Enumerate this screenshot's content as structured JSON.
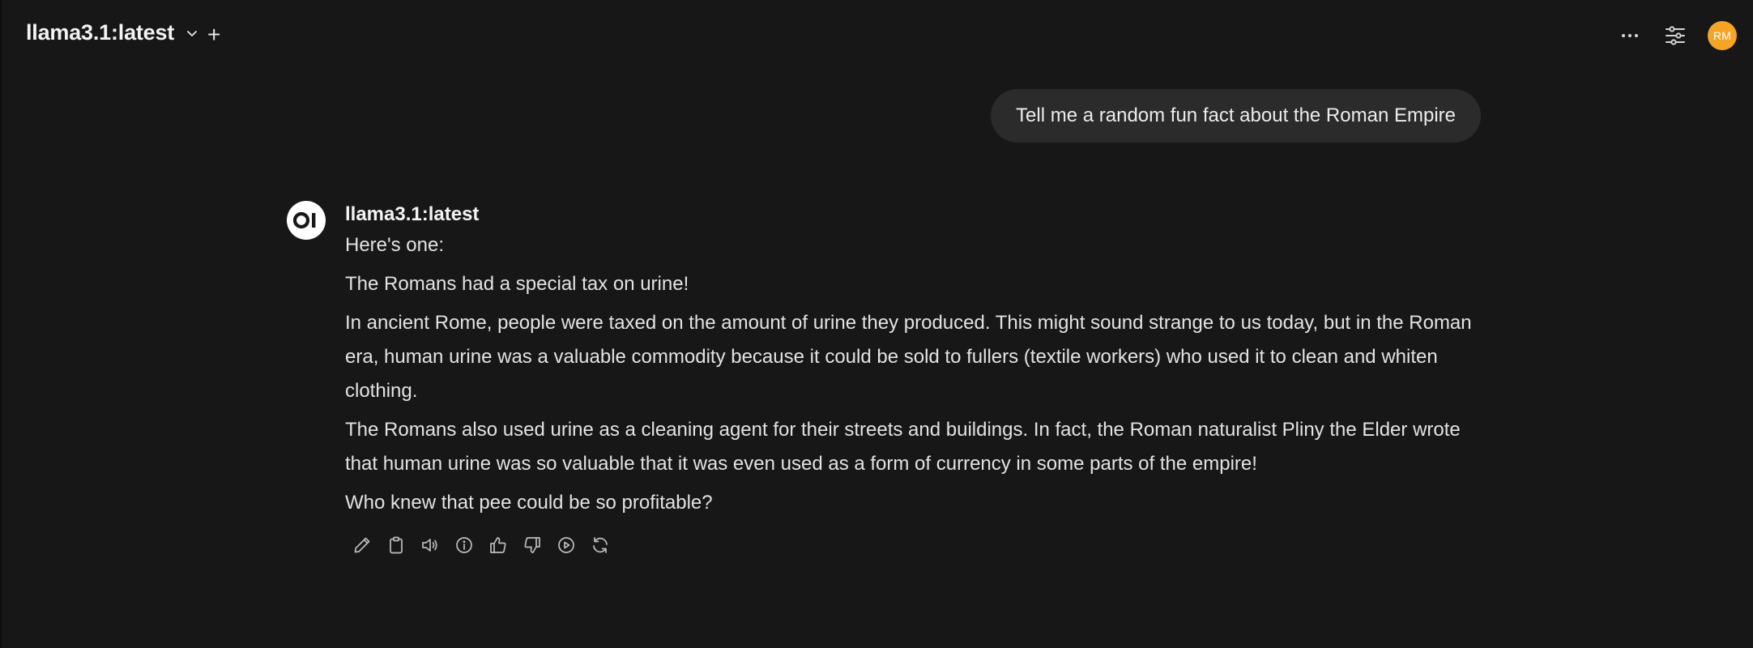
{
  "header": {
    "model_name": "llama3.1:latest",
    "add_label": "+",
    "user_initials": "RM",
    "avatar_color": "#f5a526"
  },
  "conversation": {
    "user_message": "Tell me a random fun fact about the Roman Empire",
    "assistant": {
      "name": "llama3.1:latest",
      "paragraphs": [
        "Here's one:",
        "The Romans had a special tax on urine!",
        "In ancient Rome, people were taxed on the amount of urine they produced. This might sound strange to us today, but in the Roman era, human urine was a valuable commodity because it could be sold to fullers (textile workers) who used it to clean and whiten clothing.",
        "The Romans also used urine as a cleaning agent for their streets and buildings. In fact, the Roman naturalist Pliny the Elder wrote that human urine was so valuable that it was even used as a form of currency in some parts of the empire!",
        "Who knew that pee could be so profitable?"
      ],
      "actions": [
        "edit-icon",
        "copy-icon",
        "read-aloud-icon",
        "info-icon",
        "thumbs-up-icon",
        "thumbs-down-icon",
        "continue-icon",
        "regenerate-icon"
      ]
    }
  }
}
